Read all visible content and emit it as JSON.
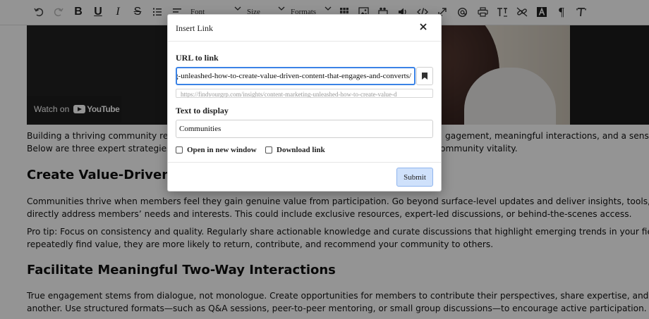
{
  "toolbar": {
    "font_label": "Font",
    "size_label": "Size",
    "formats_label": "Formats",
    "icons": [
      "undo-icon",
      "redo-icon",
      "bold-icon",
      "underline-icon",
      "italic-icon",
      "strikethrough-icon",
      "numbered-list-icon",
      "align-icon",
      "table-icon",
      "image-icon",
      "media-icon",
      "audio-icon",
      "code-icon",
      "fullscreen-icon",
      "mention-icon",
      "print-icon",
      "clear-format-icon",
      "link-icon",
      "text-color-icon",
      "paragraph-icon",
      "text-format-icon"
    ]
  },
  "video": {
    "watch_on": "Watch on",
    "youtube": "YouTube"
  },
  "content": {
    "p1_line1_left": "Building a thriving community req",
    "p1_line1_right": "gagement, meaningful interactions, and a sense of",
    "p1_line2_left": "Below are three expert strategies t",
    "p1_line2_right": "ommunity vitality.",
    "h2_1": "Create Value-Driven C",
    "p2_line1": "Communities thrive when members feel they gain genuine value from participation. Go beyond surface-level updates and deliver insights, tools, or exp",
    "p2_line2": "directly address members’ needs and interests. This could include exclusive resources, expert-led discussions, or behind-the-scenes access.",
    "p3_line1": "Pro tip: Focus on consistency and quality. Regularly share actionable knowledge and curate discussions that highlight emerging trends in your field. Wh",
    "p3_line2": "repeatedly find value, they are more likely to return, contribute, and recommend your community to others.",
    "h2_2": "Facilitate Meaningful Two-Way Interactions",
    "p4_line1": "True engagement stems from dialogue, not monologue. Create opportunities for members to contribute their perspectives, share expertise, and conne",
    "p4_line2": "another. Use structured formats—such as Q&A sessions, peer-to-peer mentoring, or small group discussions—to encourage active participation."
  },
  "dialog": {
    "title": "Insert Link",
    "url_label": "URL to link",
    "url_value": "g-unleashed-how-to-create-value-driven-content-that-engages-and-converts/",
    "url_suggestion": "https://findyourgrp.com/insights/content-marketing-unleashed-how-to-create-value-d",
    "text_label": "Text to display",
    "text_value": "Communities",
    "open_new_window": "Open in new window",
    "download_link": "Download link",
    "submit": "Submit"
  }
}
